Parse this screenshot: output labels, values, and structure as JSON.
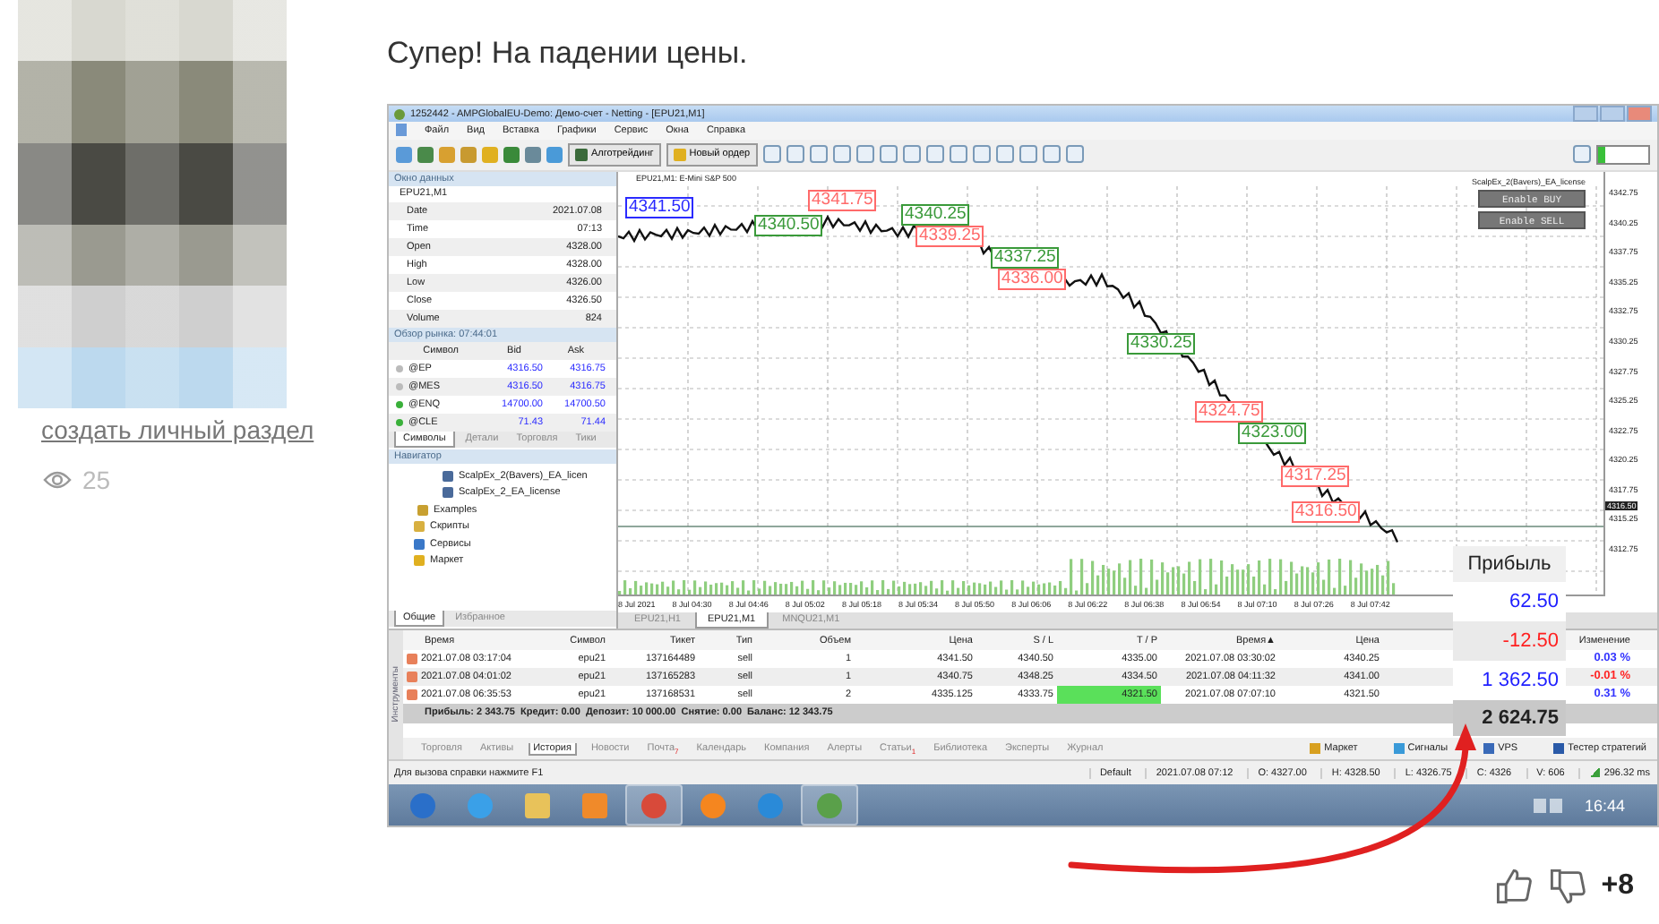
{
  "author": {
    "link": "создать личный раздел",
    "views": "25"
  },
  "post": {
    "text": "Супер! На падении цены."
  },
  "window": {
    "title": "1252442 - AMPGlobalEU-Demo: Демо-счет - Netting - [EPU21,M1]",
    "menu": [
      "Файл",
      "Вид",
      "Вставка",
      "Графики",
      "Сервис",
      "Окна",
      "Справка"
    ],
    "toolbar": [
      {
        "label": "Алготрейдинг",
        "kind": "algo"
      },
      {
        "label": "Новый ордер",
        "kind": "order"
      }
    ]
  },
  "data_window": {
    "title": "Окно данных",
    "symbol": "EPU21,M1",
    "rows": [
      {
        "label": "Date",
        "value": "2021.07.08"
      },
      {
        "label": "Time",
        "value": "07:13"
      },
      {
        "label": "Open",
        "value": "4328.00"
      },
      {
        "label": "High",
        "value": "4328.00"
      },
      {
        "label": "Low",
        "value": "4326.00"
      },
      {
        "label": "Close",
        "value": "4326.50"
      },
      {
        "label": "Volume",
        "value": "824"
      }
    ]
  },
  "market_watch": {
    "title": "Обзор рынка: 07:44:01",
    "columns": [
      "Символ",
      "Bid",
      "Ask"
    ],
    "rows": [
      {
        "symbol": "@EP",
        "bid": "4316.50",
        "ask": "4316.75",
        "active": false
      },
      {
        "symbol": "@MES",
        "bid": "4316.50",
        "ask": "4316.75",
        "active": false
      },
      {
        "symbol": "@ENQ",
        "bid": "14700.00",
        "ask": "14700.50",
        "active": true
      },
      {
        "symbol": "@CLE",
        "bid": "71.43",
        "ask": "71.44",
        "active": true
      }
    ],
    "tabs": [
      {
        "label": "Символы",
        "selected": true
      },
      {
        "label": "Детали",
        "selected": false
      },
      {
        "label": "Торговля",
        "selected": false
      },
      {
        "label": "Тики",
        "selected": false
      }
    ]
  },
  "navigator": {
    "title": "Навигатор",
    "items": [
      {
        "label": "ScalpEx_2(Bavers)_EA_licen",
        "kind": "expert"
      },
      {
        "label": "ScalpEx_2_EA_license",
        "kind": "expert"
      },
      {
        "label": "Examples",
        "kind": "folder"
      },
      {
        "label": "Скрипты",
        "kind": "scripts"
      },
      {
        "label": "Сервисы",
        "kind": "services"
      },
      {
        "label": "Маркет",
        "kind": "market"
      }
    ],
    "tabs": [
      {
        "label": "Общие",
        "selected": true
      },
      {
        "label": "Избранное",
        "selected": false
      }
    ]
  },
  "chart": {
    "title": "EPU21,M1: E-Mini S&P 500",
    "ea_name": "ScalpEx_2(Bavers)_EA_license",
    "buttons": [
      "Enable BUY",
      "Enable SELL"
    ],
    "trade_labels": [
      {
        "text": "4341.50",
        "kind": "open"
      },
      {
        "text": "4340.50",
        "kind": "profit"
      },
      {
        "text": "4341.75",
        "kind": "loss"
      },
      {
        "text": "4340.25",
        "kind": "profit"
      },
      {
        "text": "4339.25",
        "kind": "loss"
      },
      {
        "text": "4337.25",
        "kind": "profit"
      },
      {
        "text": "4336.00",
        "kind": "loss"
      },
      {
        "text": "4330.25",
        "kind": "profit"
      },
      {
        "text": "4324.75",
        "kind": "loss"
      },
      {
        "text": "4323.00",
        "kind": "profit"
      },
      {
        "text": "4317.25",
        "kind": "loss"
      },
      {
        "text": "4316.50",
        "kind": "loss"
      }
    ],
    "price_labels": [
      "4342.75",
      "4340.25",
      "4337.75",
      "4335.25",
      "4332.75",
      "4330.25",
      "4327.75",
      "4325.25",
      "4322.75",
      "4320.25",
      "4317.75",
      "4315.25",
      "4312.75"
    ],
    "current_price": "4316.50",
    "time_labels": [
      "8 Jul 2021",
      "8 Jul 04:30",
      "8 Jul 04:46",
      "8 Jul 05:02",
      "8 Jul 05:18",
      "8 Jul 05:34",
      "8 Jul 05:50",
      "8 Jul 06:06",
      "8 Jul 06:22",
      "8 Jul 06:38",
      "8 Jul 06:54",
      "8 Jul 07:10",
      "8 Jul 07:26",
      "8 Jul 07:42"
    ],
    "tabs": [
      {
        "label": "EPU21,H1",
        "selected": false
      },
      {
        "label": "EPU21,M1",
        "selected": true
      },
      {
        "label": "MNQU21,M1",
        "selected": false
      }
    ]
  },
  "toolbox": {
    "side_label": "Инструменты",
    "columns": [
      {
        "label": "Время"
      },
      {
        "label": "Символ"
      },
      {
        "label": "Тикет"
      },
      {
        "label": "Тип"
      },
      {
        "label": "Объем"
      },
      {
        "label": "Цена"
      },
      {
        "label": "S / L"
      },
      {
        "label": "T / P"
      },
      {
        "label": "Время",
        "sort": "▲"
      },
      {
        "label": "Цена"
      },
      {
        "label": "Изменение"
      }
    ],
    "rows": [
      {
        "cells": [
          "2021.07.08 03:17:04",
          "epu21",
          "137164489",
          "sell",
          "1",
          "4341.50",
          "4340.50",
          "4335.00",
          "2021.07.08 03:30:02",
          "4340.25"
        ],
        "change": "0.03 %",
        "color": "#3333ff",
        "tp_reached": false
      },
      {
        "cells": [
          "2021.07.08 04:01:02",
          "epu21",
          "137165283",
          "sell",
          "1",
          "4340.75",
          "4348.25",
          "4334.50",
          "2021.07.08 04:11:32",
          "4341.00"
        ],
        "change": "-0.01 %",
        "color": "#ff2222",
        "tp_reached": false
      },
      {
        "cells": [
          "2021.07.08 06:35:53",
          "epu21",
          "137168531",
          "sell",
          "2",
          "4335.125",
          "4333.75",
          "4321.50",
          "2021.07.08 07:07:10",
          "4321.50"
        ],
        "change": "0.31 %",
        "color": "#3333ff",
        "tp_reached": true
      }
    ],
    "summary": "Прибыль: 2 343.75  Кредит: 0.00  Депозит: 10 000.00  Снятие: 0.00  Баланс: 12 343.75",
    "tabs": [
      {
        "label": "Торговля",
        "selected": false
      },
      {
        "label": "Активы",
        "selected": false
      },
      {
        "label": "История",
        "selected": true
      },
      {
        "label": "Новости",
        "selected": false
      },
      {
        "label": "Почта",
        "selected": false,
        "badge": "7"
      },
      {
        "label": "Календарь",
        "selected": false
      },
      {
        "label": "Компания",
        "selected": false
      },
      {
        "label": "Алерты",
        "selected": false
      },
      {
        "label": "Статьи",
        "selected": false,
        "badge": "1"
      },
      {
        "label": "Библиотека",
        "selected": false
      },
      {
        "label": "Эксперты",
        "selected": false
      },
      {
        "label": "Журнал",
        "selected": false
      }
    ],
    "services": [
      {
        "label": "Маркет",
        "kind": "market"
      },
      {
        "label": "Сигналы",
        "kind": "signals"
      },
      {
        "label": "VPS",
        "kind": "vps"
      },
      {
        "label": "Тестер стратегий",
        "kind": "tester"
      }
    ]
  },
  "profit_overlay": {
    "title": "Прибыль",
    "values": [
      {
        "text": "62.50",
        "color": "#2020ff"
      },
      {
        "text": "-12.50",
        "color": "#ff2020"
      },
      {
        "text": "1 362.50",
        "color": "#2020ff"
      }
    ],
    "total": "2 624.75"
  },
  "status_bar": {
    "hint": "Для вызова справки нажмите F1",
    "items": [
      "Default",
      "2021.07.08 07:12",
      "O: 4327.00",
      "H: 4328.50",
      "L: 4326.75",
      "C: 4326",
      "V: 606"
    ],
    "ping": "296.32 ms"
  },
  "taskbar": {
    "apps": [
      {
        "kind": "start"
      },
      {
        "kind": "ie"
      },
      {
        "kind": "folder"
      },
      {
        "kind": "media"
      },
      {
        "kind": "chrome"
      },
      {
        "kind": "vlc"
      },
      {
        "kind": "edge"
      },
      {
        "kind": "terminal"
      }
    ],
    "clock": "16:44"
  },
  "reactions": {
    "score": "+8"
  }
}
